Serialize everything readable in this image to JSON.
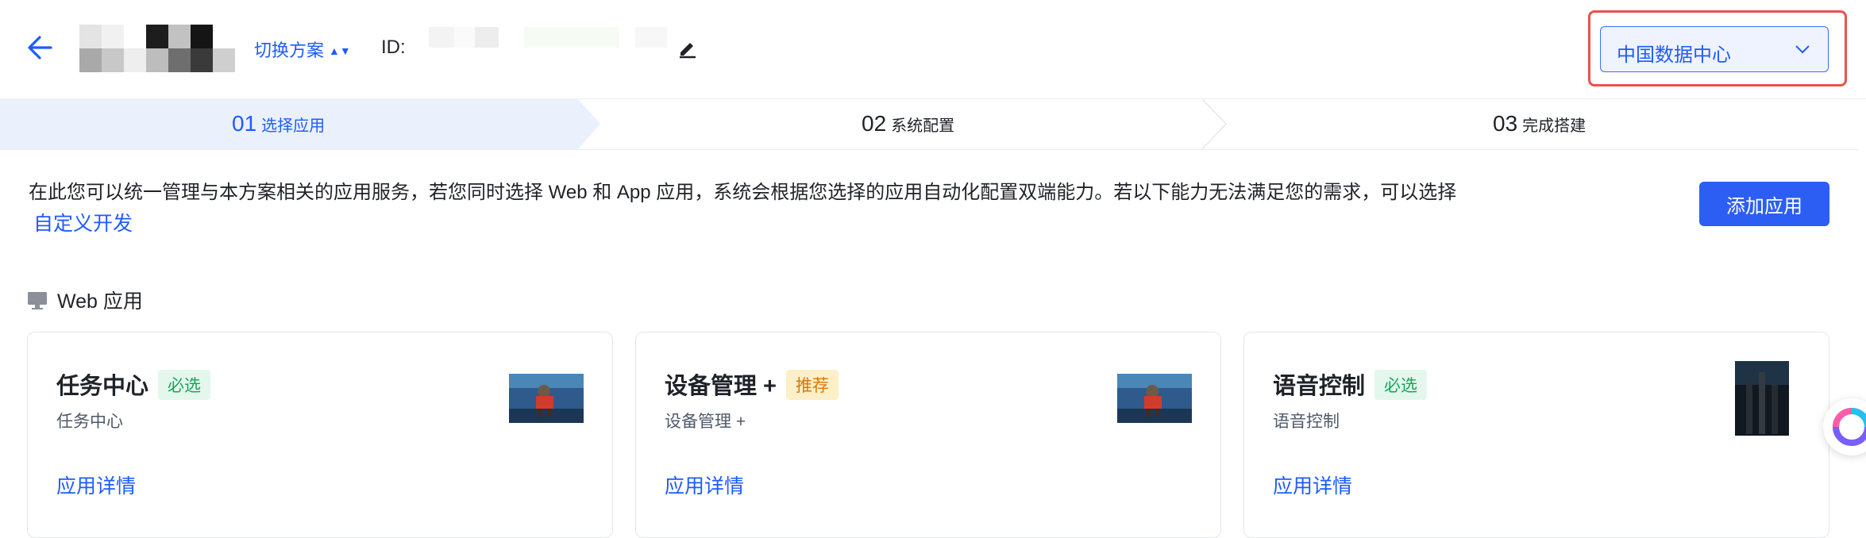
{
  "header": {
    "switch_plan_label": "切换方案",
    "id_label": "ID:",
    "data_center": {
      "selected": "中国数据中心",
      "highlight_color": "#e8534c"
    }
  },
  "steps": [
    {
      "num": "01",
      "label": "选择应用",
      "active": true
    },
    {
      "num": "02",
      "label": "系统配置",
      "active": false
    },
    {
      "num": "03",
      "label": "完成搭建",
      "active": false
    }
  ],
  "description": "在此您可以统一管理与本方案相关的应用服务，若您同时选择 Web 和 App 应用，系统会根据您选择的应用自动化配置双端能力。若以下能力无法满足您的需求，可以选择",
  "custom_dev_link": "自定义开发",
  "add_app_button": "添加应用",
  "section": {
    "title": "Web 应用"
  },
  "cards": [
    {
      "title": "任务中心",
      "badge": "必选",
      "badge_type": "required",
      "subtitle": "任务中心",
      "detail_link": "应用详情",
      "thumb": "photo-thumbnail"
    },
    {
      "title": "设备管理 +",
      "badge": "推荐",
      "badge_type": "recommended",
      "subtitle": "设备管理 +",
      "detail_link": "应用详情",
      "thumb": "photo-thumbnail"
    },
    {
      "title": "语音控制",
      "badge": "必选",
      "badge_type": "required",
      "subtitle": "语音控制",
      "detail_link": "应用详情",
      "thumb": "tower-thumbnail"
    }
  ],
  "colors": {
    "primary": "#1e5bff",
    "button": "#2c5ef4",
    "required": "#1aa45a",
    "recommended": "#d97706"
  }
}
